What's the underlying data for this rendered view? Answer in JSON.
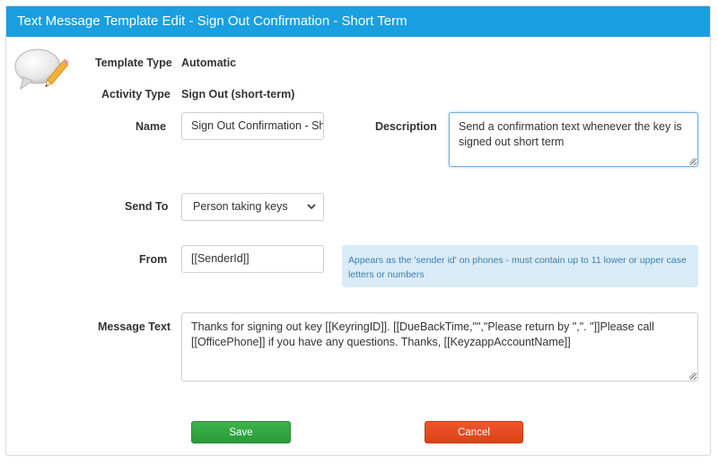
{
  "header": {
    "title": "Text Message Template Edit - Sign Out Confirmation - Short Term"
  },
  "icon": "speech-bubble-pencil-icon",
  "template_type": {
    "label": "Template Type",
    "value": "Automatic"
  },
  "activity_type": {
    "label": "Activity Type",
    "value": "Sign Out (short-term)"
  },
  "name": {
    "label": "Name",
    "value": "Sign Out Confirmation - Sho"
  },
  "description": {
    "label": "Description",
    "value": "Send a confirmation text whenever the key is signed out short term"
  },
  "send_to": {
    "label": "Send To",
    "selected": "Person taking keys"
  },
  "from": {
    "label": "From",
    "value": "[[SenderId]]",
    "hint": "Appears as the 'sender id' on phones - must contain up to 11 lower or upper case letters or numbers"
  },
  "message_text": {
    "label": "Message Text",
    "value": "Thanks for signing out key [[KeyringID]]. [[DueBackTime,\"\",\"Please return by \",\". \"]]Please call [[OfficePhone]] if you have any questions. Thanks, [[KeyzappAccountName]]"
  },
  "buttons": {
    "save": "Save",
    "cancel": "Cancel"
  },
  "colors": {
    "header": "#1a9fe0",
    "save": "#34ab43",
    "cancel": "#e84c20",
    "hint_bg": "#d9ecf7"
  }
}
